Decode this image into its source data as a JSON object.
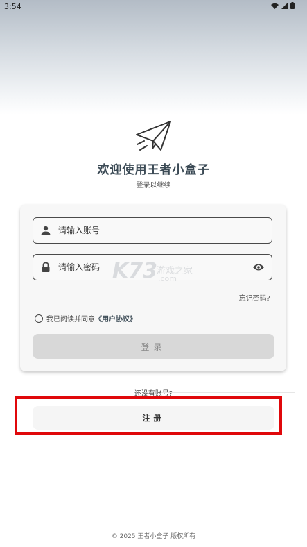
{
  "status_bar": {
    "time": "3:54"
  },
  "app": {
    "title": "欢迎使用王者小盒子",
    "subtitle": "登录以继续"
  },
  "form": {
    "account_placeholder": "请输入账号",
    "account_value": "",
    "password_placeholder": "请输入密码",
    "password_value": "",
    "forgot_password": "忘记密码?",
    "agree_prefix": "我已阅读并同意",
    "agreement_link": "《用户协议》",
    "login_label": "登录"
  },
  "register": {
    "prompt": "还没有账号?",
    "label": "注册"
  },
  "watermark": {
    "big": "K73",
    "cn": "游戏之家",
    "com": ".com"
  },
  "footer": {
    "copyright": "© 2025 王者小盒子 版权所有"
  },
  "icons": [
    "paper-plane-icon",
    "user-icon",
    "lock-icon",
    "eye-icon",
    "wifi-icon",
    "signal-icon",
    "battery-icon"
  ],
  "colors": {
    "highlight": "#e0080b",
    "title": "#3b4a55",
    "login_disabled": "#d8d8d8"
  }
}
